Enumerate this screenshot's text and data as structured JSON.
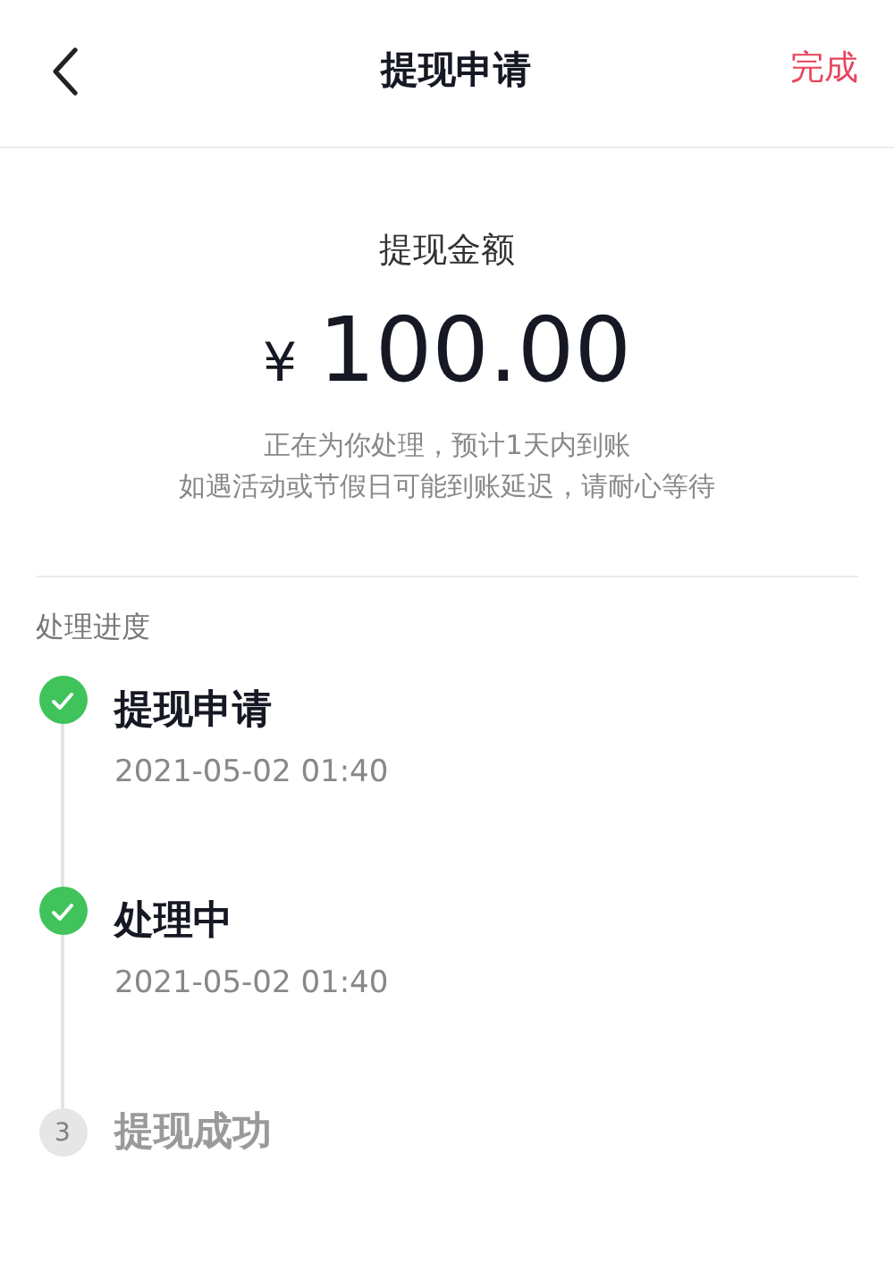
{
  "header": {
    "title": "提现申请",
    "action": "完成"
  },
  "amount": {
    "label": "提现金额",
    "currency": "¥",
    "value": "100.00",
    "notes": [
      "正在为你处理，预计1天内到账",
      "如遇活动或节假日可能到账延迟，请耐心等待"
    ]
  },
  "progress": {
    "title": "处理进度",
    "steps": [
      {
        "done": true,
        "title": "提现申请",
        "time": "2021-05-02 01:40"
      },
      {
        "done": true,
        "title": "处理中",
        "time": "2021-05-02 01:40"
      },
      {
        "done": false,
        "number": "3",
        "title": "提现成功"
      }
    ]
  }
}
